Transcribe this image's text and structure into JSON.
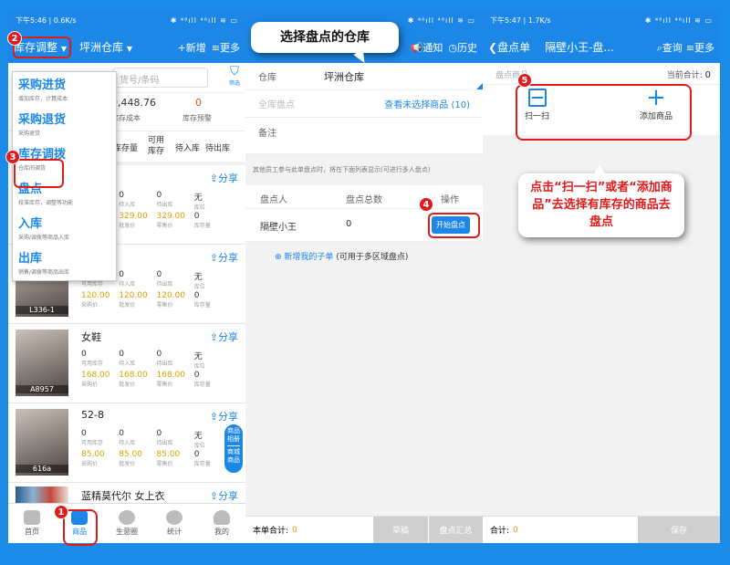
{
  "panel1": {
    "status": {
      "time": "下午5:46",
      "speed": "0.6K/s",
      "icons": "✱ ⁴⁶ıll ⁴⁶ıll ≋ ▭"
    },
    "header": {
      "dropdown": "库存调整",
      "warehouse": "坪洲仓库",
      "add": "新增",
      "more": "更多"
    },
    "search_placeholder": "货号/条码",
    "filter": "筛选",
    "summary": {
      "v1": "9,448.76",
      "l1": "库存成本",
      "v2": "0",
      "l2": "库存预警"
    },
    "cols": {
      "c1": "库存量",
      "c2": "可用库存",
      "c3": "待入库",
      "c4": "待出库"
    },
    "menu": [
      {
        "t": "采购进货",
        "s": "增加库存，计算成本"
      },
      {
        "t": "采购退货",
        "s": "采购退货"
      },
      {
        "t": "库存调拨",
        "s": "仓库间调货"
      },
      {
        "t": "盘点",
        "s": "校准库存，调整等功能"
      },
      {
        "t": "入库",
        "s": "采购/调拨等商品入库"
      },
      {
        "t": "出库",
        "s": "销售/调拨等商品出库"
      }
    ],
    "labels": {
      "avail": "可用库存",
      "in": "待入库",
      "out": "待出库",
      "loc": "库位",
      "purchase": "采购价",
      "wholesale": "批发价",
      "retail": "零售价",
      "stock": "库存量"
    },
    "share": "分享",
    "products": [
      {
        "name": "衣裙",
        "code": "",
        "v": [
          "0",
          "0",
          "0",
          "无"
        ],
        "p": [
          "0",
          "329.00",
          "329.00",
          "0"
        ]
      },
      {
        "name": "",
        "code": "L336-1",
        "v": [
          "0",
          "0",
          "0",
          "无"
        ],
        "p": [
          "120.00",
          "120.00",
          "120.00",
          "0"
        ]
      },
      {
        "name": "女鞋",
        "code": "A8957",
        "v": [
          "0",
          "0",
          "0",
          "无"
        ],
        "p": [
          "168.00",
          "168.00",
          "168.00",
          "0"
        ]
      },
      {
        "name": "52-8",
        "code": "616a",
        "v": [
          "0",
          "0",
          "0",
          "无"
        ],
        "p": [
          "85.00",
          "85.00",
          "85.00",
          "0"
        ]
      }
    ],
    "last_product": "蓝精莫代尔 女上衣",
    "float_btn": {
      "a": "商品相册",
      "b": "商城商品"
    },
    "tabs": [
      "首页",
      "商品",
      "生意圈",
      "统计",
      "我的"
    ]
  },
  "panel2": {
    "callout": "选择盘点的仓库",
    "header": {
      "notice": "通知",
      "history": "历史"
    },
    "fields": {
      "warehouse_label": "仓库",
      "warehouse": "坪洲仓库",
      "all_label": "全库盘点",
      "view_link": "查看未选择商品 (10)",
      "note_label": "备注"
    },
    "tip": "其他员工参与此单盘点时，将在下面列表显示(可进行多人盘点)",
    "table": {
      "h1": "盘点人",
      "h2": "盘点总数",
      "h3": "操作",
      "person": "隔壁小王",
      "count": "0",
      "btn": "开始盘点"
    },
    "add_sub": "新增我的子单",
    "add_sub_note": "(可用于多区域盘点)",
    "bottom": {
      "total_label": "本单合计:",
      "total": "0",
      "draft": "草稿",
      "summary": "盘点汇总"
    }
  },
  "panel3": {
    "status": {
      "time": "下午5:47",
      "speed": "1.7K/s"
    },
    "header": {
      "back": "盘点单",
      "title": "隔壁小王-盘...",
      "query": "查询",
      "more": "更多"
    },
    "list_label": "盘点商品",
    "current_total_label": "当前合计:",
    "current_total": "0",
    "scan": "扫一扫",
    "add": "添加商品",
    "callout": "点击“扫一扫”或者“添加商品”去选择有库存的商品去盘点",
    "bottom": {
      "total_label": "合计:",
      "total": "0",
      "save": "保存"
    }
  },
  "badges": [
    "1",
    "2",
    "3",
    "4",
    "5"
  ]
}
